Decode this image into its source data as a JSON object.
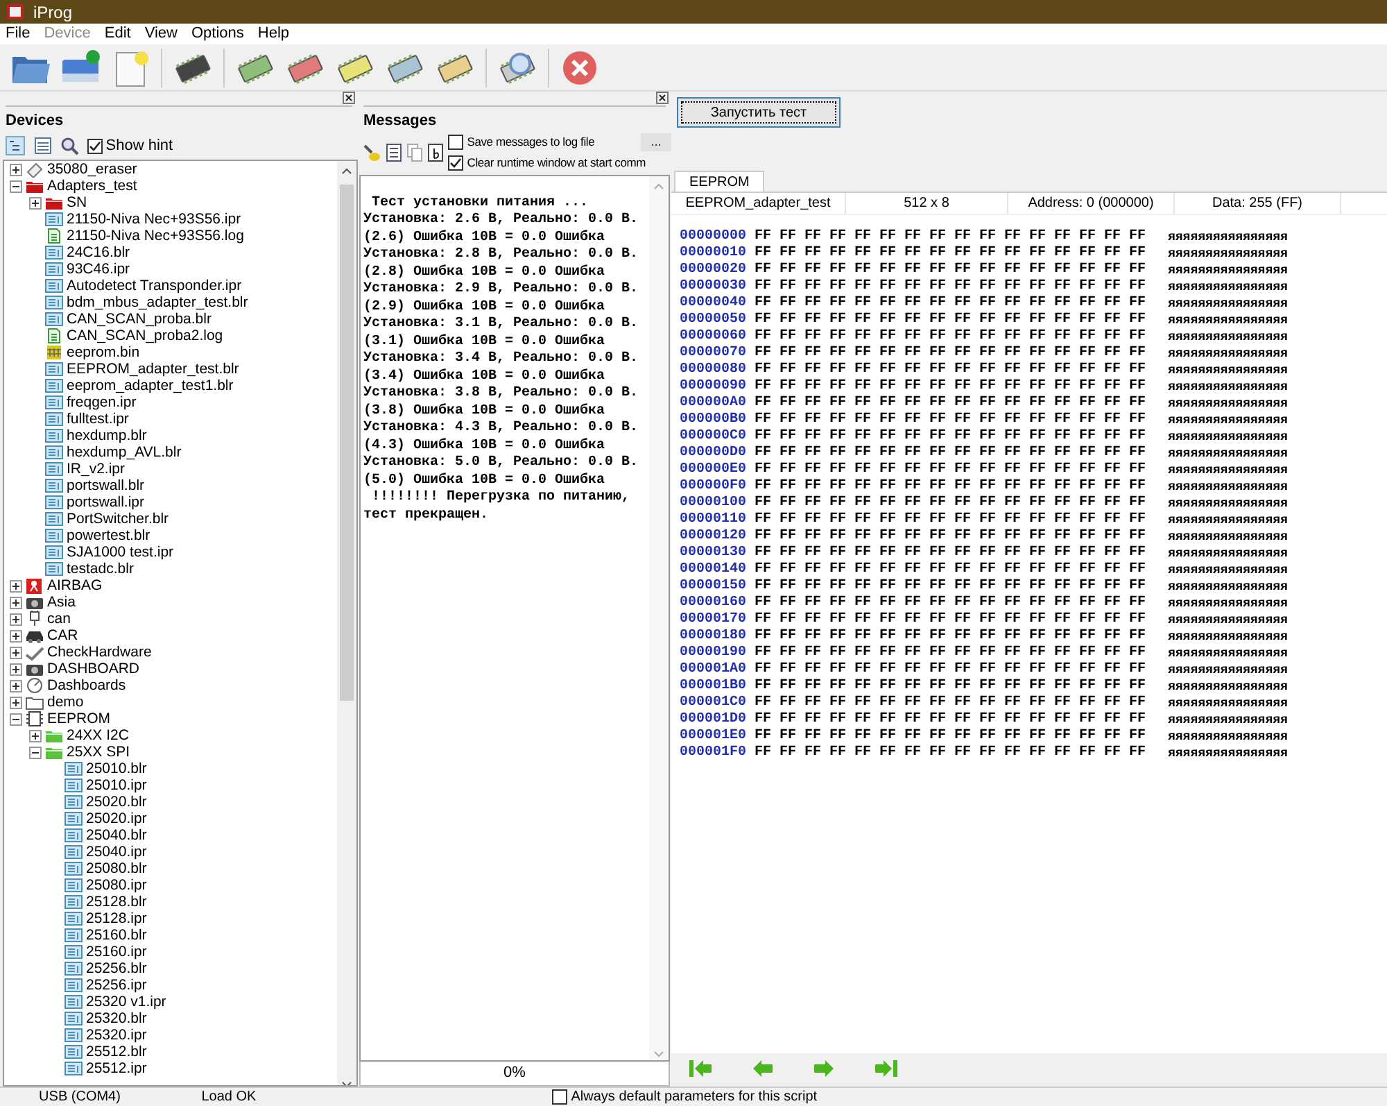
{
  "window": {
    "title": "iProg"
  },
  "menu": [
    {
      "label": "File",
      "disabled": false
    },
    {
      "label": "Device",
      "disabled": true
    },
    {
      "label": "Edit",
      "disabled": false
    },
    {
      "label": "View",
      "disabled": false
    },
    {
      "label": "Options",
      "disabled": false
    },
    {
      "label": "Help",
      "disabled": false
    }
  ],
  "devices": {
    "title": "Devices",
    "show_hint": {
      "label": "Show hint",
      "checked": true
    },
    "tree": [
      {
        "label": "35080_eraser",
        "kind": "eraser",
        "expanded": false
      },
      {
        "label": "Adapters_test",
        "kind": "folder-red",
        "expanded": true,
        "children": [
          {
            "label": "SN",
            "kind": "folder-red",
            "expanded": false
          },
          {
            "label": "21150-Niva Nec+93S56.ipr",
            "kind": "chip-file"
          },
          {
            "label": "21150-Niva Nec+93S56.log",
            "kind": "text-file"
          },
          {
            "label": "24C16.blr",
            "kind": "chip-file"
          },
          {
            "label": "93C46.ipr",
            "kind": "chip-file"
          },
          {
            "label": "Autodetect Transponder.ipr",
            "kind": "chip-file"
          },
          {
            "label": "bdm_mbus_adapter_test.blr",
            "kind": "chip-file"
          },
          {
            "label": "CAN_SCAN_proba.blr",
            "kind": "chip-file"
          },
          {
            "label": "CAN_SCAN_proba2.log",
            "kind": "text-file"
          },
          {
            "label": "eeprom.bin",
            "kind": "grid-file"
          },
          {
            "label": "EEPROM_adapter_test.blr",
            "kind": "chip-file"
          },
          {
            "label": "eeprom_adapter_test1.blr",
            "kind": "chip-file"
          },
          {
            "label": "freqgen.ipr",
            "kind": "chip-file"
          },
          {
            "label": "fulltest.ipr",
            "kind": "chip-file"
          },
          {
            "label": "hexdump.blr",
            "kind": "chip-file"
          },
          {
            "label": "hexdump_AVL.blr",
            "kind": "chip-file"
          },
          {
            "label": "IR_v2.ipr",
            "kind": "chip-file"
          },
          {
            "label": "portswall.blr",
            "kind": "chip-file"
          },
          {
            "label": "portswall.ipr",
            "kind": "chip-file"
          },
          {
            "label": "PortSwitcher.blr",
            "kind": "chip-file"
          },
          {
            "label": "powertest.blr",
            "kind": "chip-file"
          },
          {
            "label": "SJA1000 test.ipr",
            "kind": "chip-file"
          },
          {
            "label": "testadc.blr",
            "kind": "chip-file"
          }
        ]
      },
      {
        "label": "AIRBAG",
        "kind": "airbag",
        "expanded": false
      },
      {
        "label": "Asia",
        "kind": "camera",
        "expanded": false
      },
      {
        "label": "can",
        "kind": "plug",
        "expanded": false
      },
      {
        "label": "CAR",
        "kind": "car",
        "expanded": false
      },
      {
        "label": "CheckHardware",
        "kind": "check",
        "expanded": false
      },
      {
        "label": "DASHBOARD",
        "kind": "camera",
        "expanded": false
      },
      {
        "label": "Dashboards",
        "kind": "gauge",
        "expanded": false
      },
      {
        "label": "demo",
        "kind": "folder",
        "expanded": false
      },
      {
        "label": "EEPROM",
        "kind": "chip",
        "expanded": true,
        "children": [
          {
            "label": "24XX I2C",
            "kind": "folder-green",
            "expanded": false
          },
          {
            "label": "25XX SPI",
            "kind": "folder-green",
            "expanded": true,
            "children": [
              {
                "label": "25010.blr",
                "kind": "chip-file"
              },
              {
                "label": "25010.ipr",
                "kind": "chip-file"
              },
              {
                "label": "25020.blr",
                "kind": "chip-file"
              },
              {
                "label": "25020.ipr",
                "kind": "chip-file"
              },
              {
                "label": "25040.blr",
                "kind": "chip-file"
              },
              {
                "label": "25040.ipr",
                "kind": "chip-file"
              },
              {
                "label": "25080.blr",
                "kind": "chip-file"
              },
              {
                "label": "25080.ipr",
                "kind": "chip-file"
              },
              {
                "label": "25128.blr",
                "kind": "chip-file"
              },
              {
                "label": "25128.ipr",
                "kind": "chip-file"
              },
              {
                "label": "25160.blr",
                "kind": "chip-file"
              },
              {
                "label": "25160.ipr",
                "kind": "chip-file"
              },
              {
                "label": "25256.blr",
                "kind": "chip-file"
              },
              {
                "label": "25256.ipr",
                "kind": "chip-file"
              },
              {
                "label": "25320 v1.ipr",
                "kind": "chip-file"
              },
              {
                "label": "25320.blr",
                "kind": "chip-file"
              },
              {
                "label": "25320.ipr",
                "kind": "chip-file"
              },
              {
                "label": "25512.blr",
                "kind": "chip-file"
              },
              {
                "label": "25512.ipr",
                "kind": "chip-file"
              }
            ]
          }
        ]
      }
    ]
  },
  "messages": {
    "title": "Messages",
    "save_to_log": {
      "label": "Save messages to log file",
      "checked": false
    },
    "browse": "...",
    "clear_window": {
      "label": "Clear runtime window at start comm",
      "checked": true
    },
    "lines": [
      " Тест установки питания ...",
      "Установка: 2.6 В, Реально: 0.0 В.",
      "(2.6) Ошибка 10В = 0.0 Ошибка",
      "Установка: 2.8 В, Реально: 0.0 В.",
      "(2.8) Ошибка 10В = 0.0 Ошибка",
      "Установка: 2.9 В, Реально: 0.0 В.",
      "(2.9) Ошибка 10В = 0.0 Ошибка",
      "Установка: 3.1 В, Реально: 0.0 В.",
      "(3.1) Ошибка 10В = 0.0 Ошибка",
      "Установка: 3.4 В, Реально: 0.0 В.",
      "(3.4) Ошибка 10В = 0.0 Ошибка",
      "Установка: 3.8 В, Реально: 0.0 В.",
      "(3.8) Ошибка 10В = 0.0 Ошибка",
      "Установка: 4.3 В, Реально: 0.0 В.",
      "(4.3) Ошибка 10В = 0.0 Ошибка",
      "Установка: 5.0 В, Реально: 0.0 В.",
      "(5.0) Ошибка 10В = 0.0 Ошибка",
      " !!!!!!!! Перегрузка по питанию,",
      "тест прекращен."
    ],
    "progress": "0%"
  },
  "run_button": "Запустить тест",
  "editor": {
    "tab": "EEPROM",
    "info": [
      "EEPROM_adapter_test",
      "512 x 8",
      "Address: 0 (000000)",
      "Data: 255 (FF)"
    ],
    "rows": [
      {
        "address": "00000000",
        "bytes": "FF FF FF FF FF FF FF FF FF FF FF FF FF FF FF FF",
        "ascii": "яяяяяяяяяяяяяяяя"
      },
      {
        "address": "00000010",
        "bytes": "FF FF FF FF FF FF FF FF FF FF FF FF FF FF FF FF",
        "ascii": "яяяяяяяяяяяяяяяя"
      },
      {
        "address": "00000020",
        "bytes": "FF FF FF FF FF FF FF FF FF FF FF FF FF FF FF FF",
        "ascii": "яяяяяяяяяяяяяяяя"
      },
      {
        "address": "00000030",
        "bytes": "FF FF FF FF FF FF FF FF FF FF FF FF FF FF FF FF",
        "ascii": "яяяяяяяяяяяяяяяя"
      },
      {
        "address": "00000040",
        "bytes": "FF FF FF FF FF FF FF FF FF FF FF FF FF FF FF FF",
        "ascii": "яяяяяяяяяяяяяяяя"
      },
      {
        "address": "00000050",
        "bytes": "FF FF FF FF FF FF FF FF FF FF FF FF FF FF FF FF",
        "ascii": "яяяяяяяяяяяяяяяя"
      },
      {
        "address": "00000060",
        "bytes": "FF FF FF FF FF FF FF FF FF FF FF FF FF FF FF FF",
        "ascii": "яяяяяяяяяяяяяяяя"
      },
      {
        "address": "00000070",
        "bytes": "FF FF FF FF FF FF FF FF FF FF FF FF FF FF FF FF",
        "ascii": "яяяяяяяяяяяяяяяя"
      },
      {
        "address": "00000080",
        "bytes": "FF FF FF FF FF FF FF FF FF FF FF FF FF FF FF FF",
        "ascii": "яяяяяяяяяяяяяяяя"
      },
      {
        "address": "00000090",
        "bytes": "FF FF FF FF FF FF FF FF FF FF FF FF FF FF FF FF",
        "ascii": "яяяяяяяяяяяяяяяя"
      },
      {
        "address": "000000A0",
        "bytes": "FF FF FF FF FF FF FF FF FF FF FF FF FF FF FF FF",
        "ascii": "яяяяяяяяяяяяяяяя"
      },
      {
        "address": "000000B0",
        "bytes": "FF FF FF FF FF FF FF FF FF FF FF FF FF FF FF FF",
        "ascii": "яяяяяяяяяяяяяяяя"
      },
      {
        "address": "000000C0",
        "bytes": "FF FF FF FF FF FF FF FF FF FF FF FF FF FF FF FF",
        "ascii": "яяяяяяяяяяяяяяяя"
      },
      {
        "address": "000000D0",
        "bytes": "FF FF FF FF FF FF FF FF FF FF FF FF FF FF FF FF",
        "ascii": "яяяяяяяяяяяяяяяя"
      },
      {
        "address": "000000E0",
        "bytes": "FF FF FF FF FF FF FF FF FF FF FF FF FF FF FF FF",
        "ascii": "яяяяяяяяяяяяяяяя"
      },
      {
        "address": "000000F0",
        "bytes": "FF FF FF FF FF FF FF FF FF FF FF FF FF FF FF FF",
        "ascii": "яяяяяяяяяяяяяяяя"
      },
      {
        "address": "00000100",
        "bytes": "FF FF FF FF FF FF FF FF FF FF FF FF FF FF FF FF",
        "ascii": "яяяяяяяяяяяяяяяя"
      },
      {
        "address": "00000110",
        "bytes": "FF FF FF FF FF FF FF FF FF FF FF FF FF FF FF FF",
        "ascii": "яяяяяяяяяяяяяяяя"
      },
      {
        "address": "00000120",
        "bytes": "FF FF FF FF FF FF FF FF FF FF FF FF FF FF FF FF",
        "ascii": "яяяяяяяяяяяяяяяя"
      },
      {
        "address": "00000130",
        "bytes": "FF FF FF FF FF FF FF FF FF FF FF FF FF FF FF FF",
        "ascii": "яяяяяяяяяяяяяяяя"
      },
      {
        "address": "00000140",
        "bytes": "FF FF FF FF FF FF FF FF FF FF FF FF FF FF FF FF",
        "ascii": "яяяяяяяяяяяяяяяя"
      },
      {
        "address": "00000150",
        "bytes": "FF FF FF FF FF FF FF FF FF FF FF FF FF FF FF FF",
        "ascii": "яяяяяяяяяяяяяяяя"
      },
      {
        "address": "00000160",
        "bytes": "FF FF FF FF FF FF FF FF FF FF FF FF FF FF FF FF",
        "ascii": "яяяяяяяяяяяяяяяя"
      },
      {
        "address": "00000170",
        "bytes": "FF FF FF FF FF FF FF FF FF FF FF FF FF FF FF FF",
        "ascii": "яяяяяяяяяяяяяяяя"
      },
      {
        "address": "00000180",
        "bytes": "FF FF FF FF FF FF FF FF FF FF FF FF FF FF FF FF",
        "ascii": "яяяяяяяяяяяяяяяя"
      },
      {
        "address": "00000190",
        "bytes": "FF FF FF FF FF FF FF FF FF FF FF FF FF FF FF FF",
        "ascii": "яяяяяяяяяяяяяяяя"
      },
      {
        "address": "000001A0",
        "bytes": "FF FF FF FF FF FF FF FF FF FF FF FF FF FF FF FF",
        "ascii": "яяяяяяяяяяяяяяяя"
      },
      {
        "address": "000001B0",
        "bytes": "FF FF FF FF FF FF FF FF FF FF FF FF FF FF FF FF",
        "ascii": "яяяяяяяяяяяяяяяя"
      },
      {
        "address": "000001C0",
        "bytes": "FF FF FF FF FF FF FF FF FF FF FF FF FF FF FF FF",
        "ascii": "яяяяяяяяяяяяяяяя"
      },
      {
        "address": "000001D0",
        "bytes": "FF FF FF FF FF FF FF FF FF FF FF FF FF FF FF FF",
        "ascii": "яяяяяяяяяяяяяяяя"
      },
      {
        "address": "000001E0",
        "bytes": "FF FF FF FF FF FF FF FF FF FF FF FF FF FF FF FF",
        "ascii": "яяяяяяяяяяяяяяяя"
      },
      {
        "address": "000001F0",
        "bytes": "FF FF FF FF FF FF FF FF FF FF FF FF FF FF FF FF",
        "ascii": "яяяяяяяяяяяяяяяя"
      }
    ]
  },
  "status_bar": {
    "port": "USB (COM4)",
    "state": "Load OK",
    "always_default": {
      "label": "Always default parameters for this script",
      "checked": false
    }
  }
}
